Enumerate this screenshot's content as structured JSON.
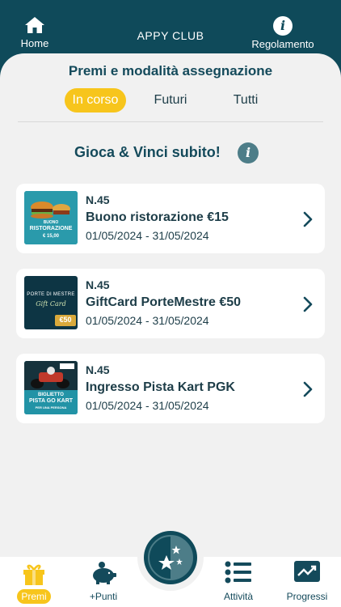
{
  "topbar": {
    "home_label": "Home",
    "title": "APPY CLUB",
    "rules_label": "Regolamento",
    "icons": {
      "home": "home-icon",
      "rules": "info-icon"
    }
  },
  "main": {
    "section_title": "Premi e modalità assegnazione",
    "tabs": [
      {
        "label": "In corso",
        "active": true
      },
      {
        "label": "Futuri",
        "active": false
      },
      {
        "label": "Tutti",
        "active": false
      }
    ],
    "game_title": "Gioca & Vinci subito!",
    "info_icon": "i"
  },
  "prizes": [
    {
      "number": "N.45",
      "name": "Buono ristorazione €15",
      "dates": "01/05/2024 - 31/05/2024",
      "thumb_lines": [
        "BUONO",
        "RISTORAZIONE",
        "€ 15,00"
      ]
    },
    {
      "number": "N.45",
      "name": "GiftCard PorteMestre €50",
      "dates": "01/05/2024 - 31/05/2024",
      "thumb_lines": [
        "PORTE DI MESTRE",
        "Gift Card",
        "€50"
      ]
    },
    {
      "number": "N.45",
      "name": "Ingresso Pista Kart PGK",
      "dates": "01/05/2024 - 31/05/2024",
      "thumb_lines": [
        "BIGLIETTO",
        "PISTA GO KART",
        "PER UNA PERSONA"
      ]
    }
  ],
  "bottomnav": {
    "items": [
      {
        "label": "Premi",
        "icon": "gift-icon",
        "active": true
      },
      {
        "label": "+Punti",
        "icon": "piggy-bank-icon",
        "active": false
      },
      {
        "label": "Attività",
        "icon": "list-icon",
        "active": false
      },
      {
        "label": "Progressi",
        "icon": "trend-chart-icon",
        "active": false
      }
    ],
    "center_icon": "stars-icon"
  },
  "colors": {
    "brand_dark": "#0f4a5a",
    "accent_yellow": "#f7c51c",
    "background": "#f1f1f1"
  }
}
